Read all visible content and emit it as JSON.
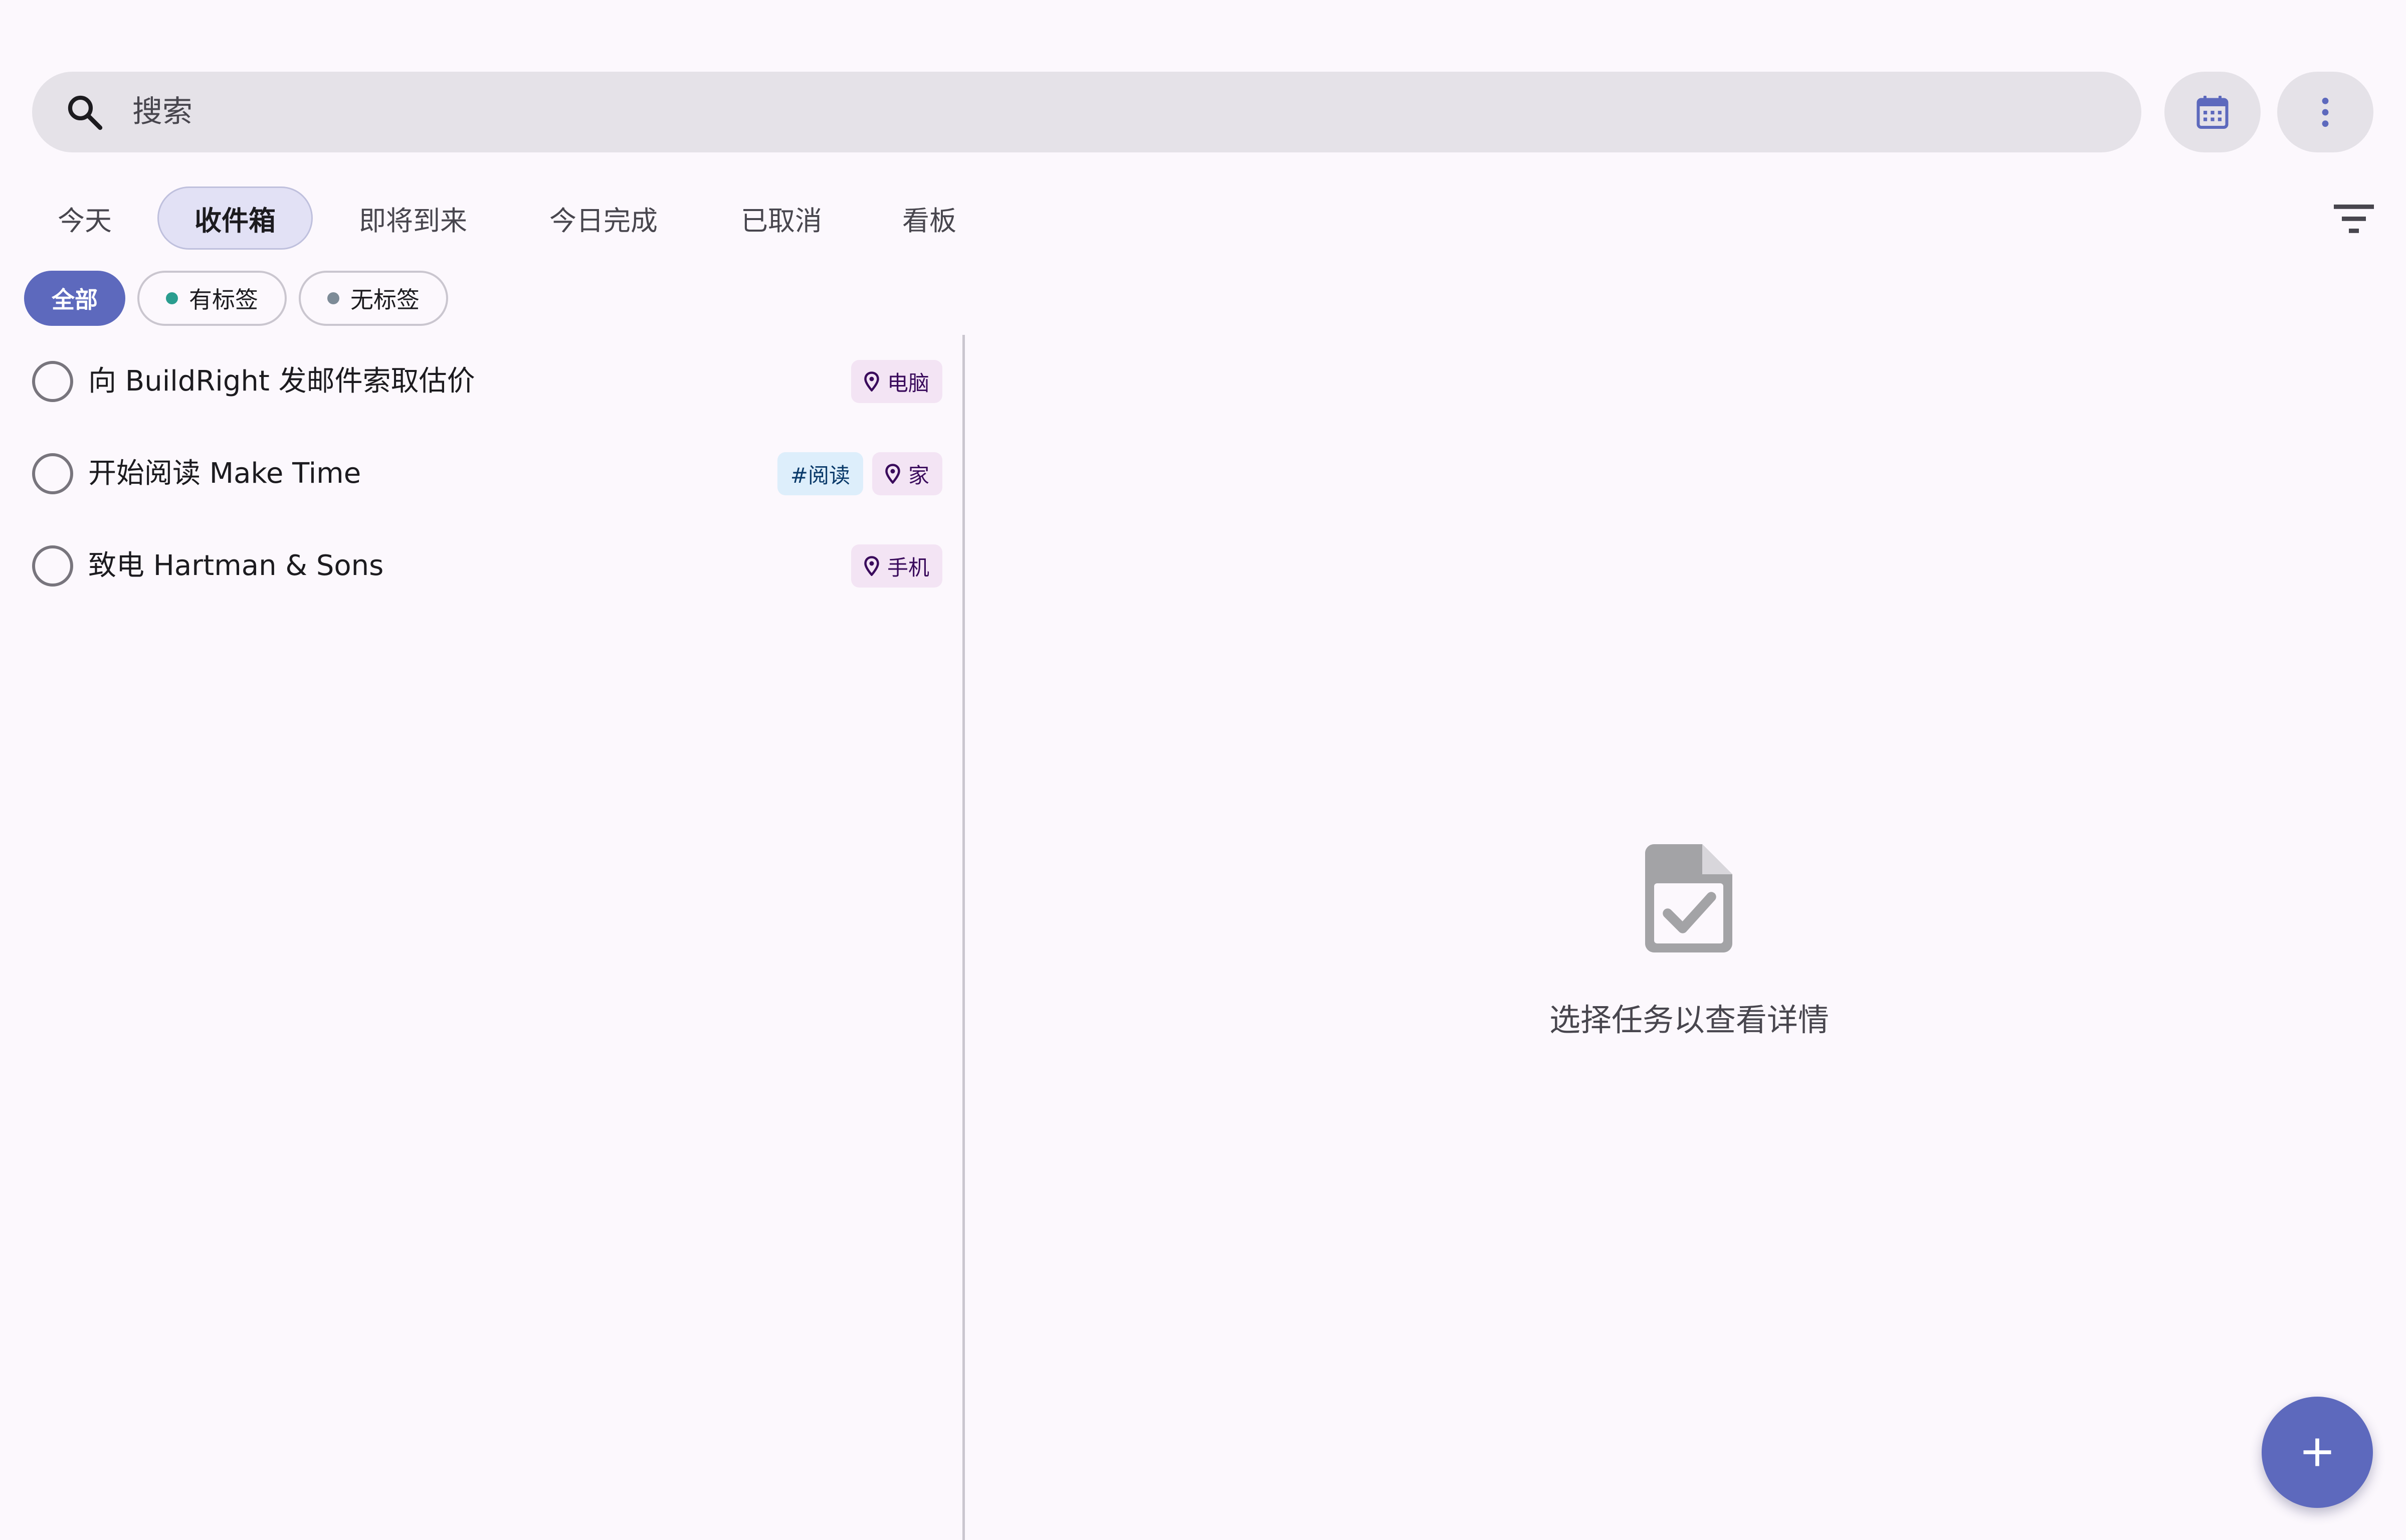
{
  "search": {
    "placeholder": "搜索"
  },
  "tabs": [
    {
      "label": "今天",
      "active": false
    },
    {
      "label": "收件箱",
      "active": true
    },
    {
      "label": "即将到来",
      "active": false
    },
    {
      "label": "今日完成",
      "active": false
    },
    {
      "label": "已取消",
      "active": false
    },
    {
      "label": "看板",
      "active": false
    }
  ],
  "chips": [
    {
      "label": "全部",
      "active": true
    },
    {
      "label": "有标签",
      "active": false,
      "dot_color": "#2a9d8f"
    },
    {
      "label": "无标签",
      "active": false,
      "dot_color": "#7d8b97"
    }
  ],
  "tasks": [
    {
      "title": "向 BuildRight 发邮件索取估价",
      "tags": [
        {
          "type": "context",
          "label": "电脑"
        }
      ]
    },
    {
      "title": "开始阅读 Make Time",
      "tags": [
        {
          "type": "hashtag",
          "label": "#阅读"
        },
        {
          "type": "context",
          "label": "家"
        }
      ]
    },
    {
      "title": "致电 Hartman & Sons",
      "tags": [
        {
          "type": "context",
          "label": "手机"
        }
      ]
    }
  ],
  "detail": {
    "empty_text": "选择任务以查看详情"
  },
  "icons": {
    "search": "search-icon",
    "calendar": "calendar-icon",
    "more": "more-vert-icon",
    "filter": "filter-icon",
    "pin": "location-pin-icon",
    "empty": "document-check-icon",
    "fab": "plus-icon"
  },
  "colors": {
    "accent": "#5d69bd",
    "background": "#fcf8fd",
    "surface": "#e5e2e8",
    "context_tag_bg": "#f3e4f4",
    "hashtag_tag_bg": "#ddeefb"
  }
}
